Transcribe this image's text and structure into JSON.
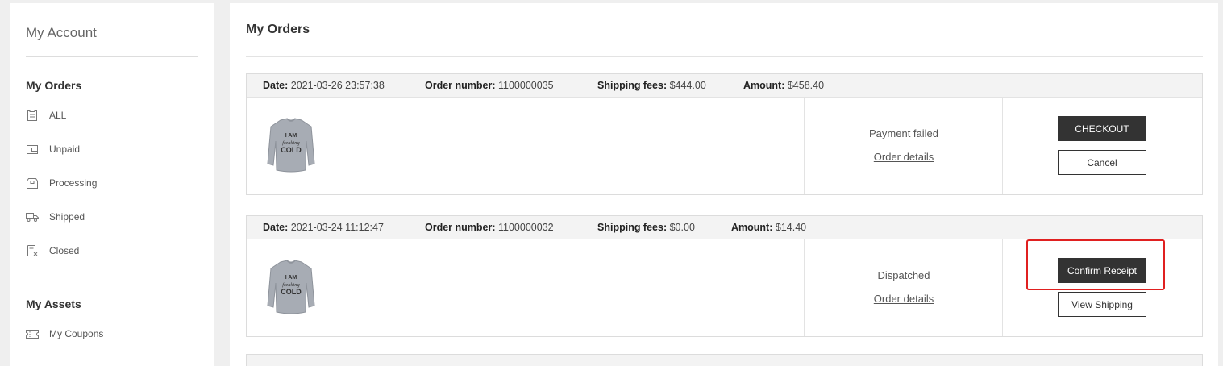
{
  "sidebar": {
    "title": "My Account",
    "orders_section": "My Orders",
    "order_items": [
      {
        "label": "ALL",
        "icon": "document-list-icon"
      },
      {
        "label": "Unpaid",
        "icon": "wallet-icon"
      },
      {
        "label": "Processing",
        "icon": "box-icon"
      },
      {
        "label": "Shipped",
        "icon": "truck-icon"
      },
      {
        "label": "Closed",
        "icon": "document-x-icon"
      }
    ],
    "assets_section": "My Assets",
    "asset_items": [
      {
        "label": "My Coupons",
        "icon": "coupon-icon"
      }
    ]
  },
  "main": {
    "title": "My Orders",
    "labels": {
      "date": "Date:",
      "order_number": "Order number:",
      "shipping_fees": "Shipping fees:",
      "amount": "Amount:"
    },
    "orders": [
      {
        "date": "2021-03-26 23:57:38",
        "order_number": "1100000035",
        "shipping_fees": "$444.00",
        "amount": "$458.40",
        "product_image": "grey-sweatshirt-i-am-freaking-cold",
        "status": "Payment failed",
        "details_link": "Order details",
        "primary_action": "CHECKOUT",
        "secondary_action": "Cancel"
      },
      {
        "date": "2021-03-24 11:12:47",
        "order_number": "1100000032",
        "shipping_fees": "$0.00",
        "amount": "$14.40",
        "product_image": "grey-sweatshirt-i-am-freaking-cold",
        "status": "Dispatched",
        "details_link": "Order details",
        "primary_action": "Confirm Receipt",
        "secondary_action": "View Shipping"
      }
    ]
  },
  "colors": {
    "dark_button": "#333333",
    "highlight": "#e02020",
    "header_bg": "#f3f3f3",
    "page_bg": "#efefef"
  }
}
